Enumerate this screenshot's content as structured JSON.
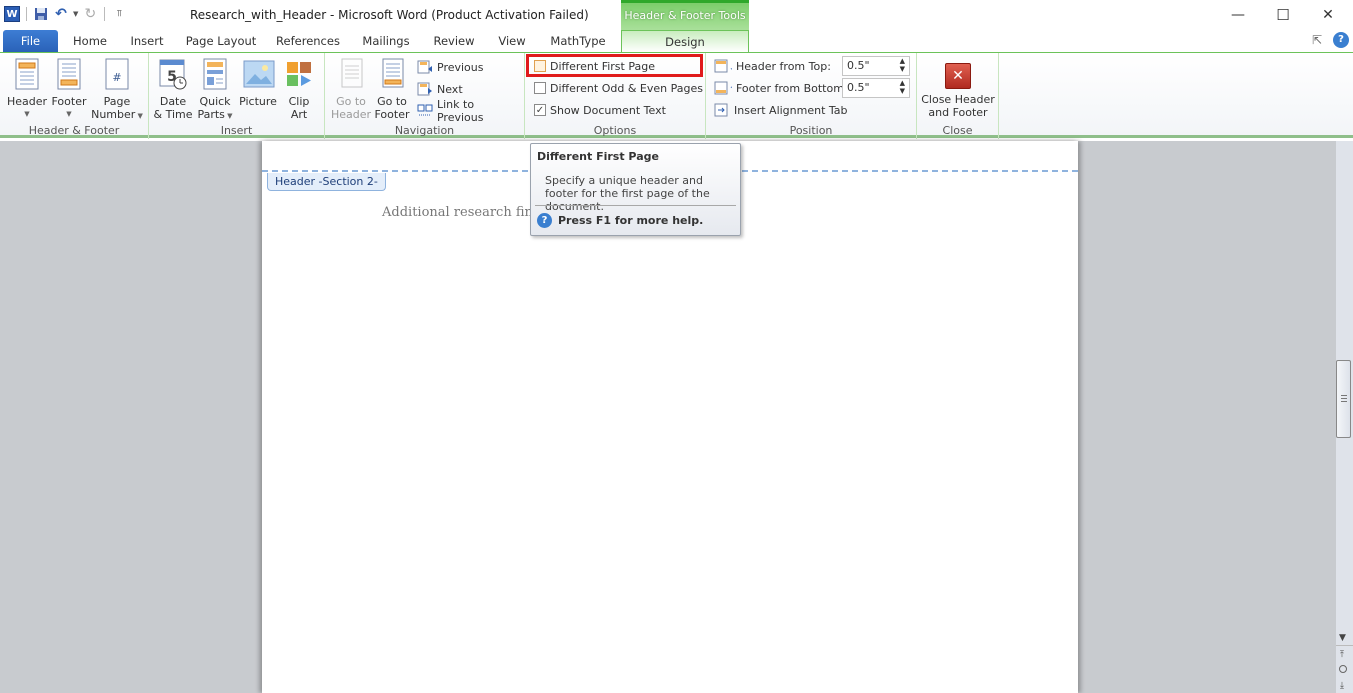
{
  "titlebar": {
    "title": "Research_with_Header  -  Microsoft Word (Product Activation Failed)",
    "contextual_tab_group": "Header & Footer Tools",
    "minimize": "—",
    "maximize": "☐",
    "close": "✕",
    "qat_icons": [
      "word-logo-icon",
      "save-icon",
      "undo-icon",
      "redo-icon",
      "customize-qat-icon"
    ]
  },
  "tabs": [
    {
      "label": "File"
    },
    {
      "label": "Home"
    },
    {
      "label": "Insert"
    },
    {
      "label": "Page Layout"
    },
    {
      "label": "References"
    },
    {
      "label": "Mailings"
    },
    {
      "label": "Review"
    },
    {
      "label": "View"
    },
    {
      "label": "MathType"
    },
    {
      "label": "Design",
      "active": true
    }
  ],
  "ribbon": {
    "groups": {
      "header_footer": {
        "label": "Header & Footer",
        "header": "Header",
        "footer": "Footer",
        "page_number_1": "Page",
        "page_number_2": "Number"
      },
      "insert": {
        "label": "Insert",
        "date_1": "Date",
        "date_2": "& Time",
        "quick_1": "Quick",
        "quick_2": "Parts",
        "picture": "Picture",
        "clip_1": "Clip",
        "clip_2": "Art"
      },
      "navigation": {
        "label": "Navigation",
        "goto_header_1": "Go to",
        "goto_header_2": "Header",
        "goto_footer_1": "Go to",
        "goto_footer_2": "Footer",
        "previous": "Previous",
        "next": "Next",
        "link_previous": "Link to Previous"
      },
      "options": {
        "label": "Options",
        "different_first": "Different First Page",
        "different_first_checked": false,
        "odd_even": "Different Odd & Even Pages",
        "odd_even_checked": false,
        "show_text": "Show Document Text",
        "show_text_checked": true
      },
      "position": {
        "label": "Position",
        "header_top_label": "Header from Top:",
        "header_top_value": "0.5\"",
        "footer_bottom_label": "Footer from Bottom:",
        "footer_bottom_value": "0.5\"",
        "align_tab": "Insert Alignment Tab"
      },
      "close": {
        "label": "Close",
        "close_1": "Close Header",
        "close_2": "and Footer"
      }
    }
  },
  "document": {
    "header_tag": "Header -Section 2-",
    "body_text": "Additional research find"
  },
  "tooltip": {
    "title": "Different First Page",
    "body": "Specify a unique header and footer for the first page of the document.",
    "help": "Press F1 for more help."
  },
  "colors": {
    "accent_green": "#6cc35a",
    "file_tab_blue": "#2a62b8",
    "highlight_red": "#e01b1b"
  }
}
